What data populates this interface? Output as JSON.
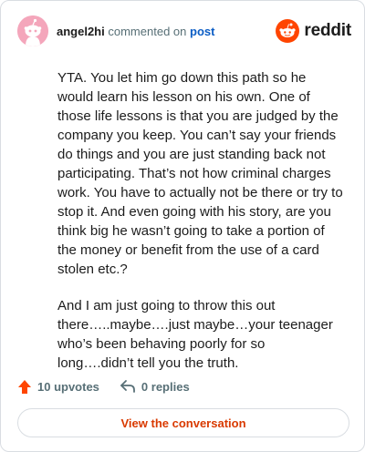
{
  "header": {
    "username": "angel2hi",
    "action_text": "commented on",
    "post_link_label": "post",
    "brand_name": "reddit"
  },
  "comment": {
    "paragraphs": [
      "YTA. You let him go down this path so he would learn his lesson on his own. One of those life lessons is that you are judged by the company you keep. You can’t say your friends do things and you are just standing back not participating. That’s not how criminal charges work. You have to actually not be there or try to stop it. And even going with his story, are you think big he wasn’t going to take a portion of the money or benefit from the use of a card stolen etc.?",
      "And I am just going to throw this out there…..maybe….just maybe…your teenager who’s been behaving poorly for so long….didn’t tell you the truth."
    ]
  },
  "actions": {
    "upvotes_label": "10 upvotes",
    "replies_label": "0 replies"
  },
  "cta": {
    "label": "View the conversation"
  },
  "icons": {
    "avatar": "snoo-avatar-icon",
    "brand": "reddit-logo-icon",
    "upvote": "upvote-arrow-icon",
    "reply": "reply-arrow-icon"
  },
  "colors": {
    "brand_orange": "#ff4500",
    "cta_text": "#d93a00",
    "link_blue": "#0b5dc5",
    "avatar_bg": "#f4a6bb",
    "muted_text": "#576f76"
  }
}
